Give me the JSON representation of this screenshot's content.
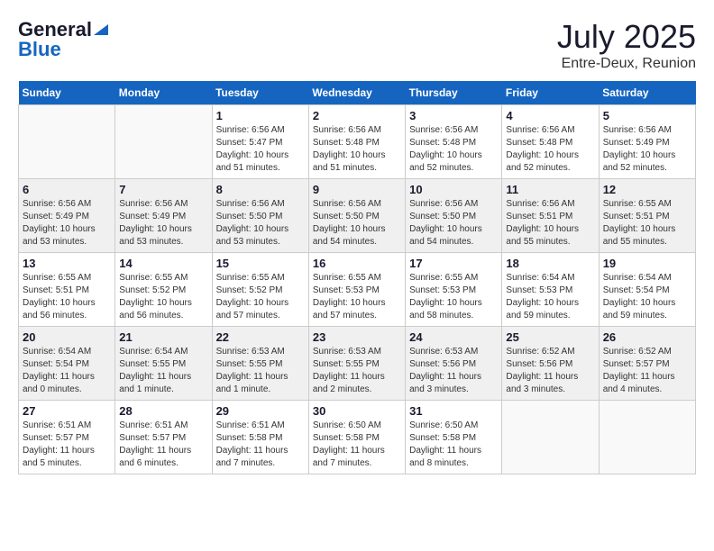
{
  "header": {
    "logo_general": "General",
    "logo_blue": "Blue",
    "month_title": "July 2025",
    "location": "Entre-Deux, Reunion"
  },
  "days_of_week": [
    "Sunday",
    "Monday",
    "Tuesday",
    "Wednesday",
    "Thursday",
    "Friday",
    "Saturday"
  ],
  "weeks": [
    [
      {
        "day": "",
        "info": ""
      },
      {
        "day": "",
        "info": ""
      },
      {
        "day": "1",
        "info": "Sunrise: 6:56 AM\nSunset: 5:47 PM\nDaylight: 10 hours and 51 minutes."
      },
      {
        "day": "2",
        "info": "Sunrise: 6:56 AM\nSunset: 5:48 PM\nDaylight: 10 hours and 51 minutes."
      },
      {
        "day": "3",
        "info": "Sunrise: 6:56 AM\nSunset: 5:48 PM\nDaylight: 10 hours and 52 minutes."
      },
      {
        "day": "4",
        "info": "Sunrise: 6:56 AM\nSunset: 5:48 PM\nDaylight: 10 hours and 52 minutes."
      },
      {
        "day": "5",
        "info": "Sunrise: 6:56 AM\nSunset: 5:49 PM\nDaylight: 10 hours and 52 minutes."
      }
    ],
    [
      {
        "day": "6",
        "info": "Sunrise: 6:56 AM\nSunset: 5:49 PM\nDaylight: 10 hours and 53 minutes."
      },
      {
        "day": "7",
        "info": "Sunrise: 6:56 AM\nSunset: 5:49 PM\nDaylight: 10 hours and 53 minutes."
      },
      {
        "day": "8",
        "info": "Sunrise: 6:56 AM\nSunset: 5:50 PM\nDaylight: 10 hours and 53 minutes."
      },
      {
        "day": "9",
        "info": "Sunrise: 6:56 AM\nSunset: 5:50 PM\nDaylight: 10 hours and 54 minutes."
      },
      {
        "day": "10",
        "info": "Sunrise: 6:56 AM\nSunset: 5:50 PM\nDaylight: 10 hours and 54 minutes."
      },
      {
        "day": "11",
        "info": "Sunrise: 6:56 AM\nSunset: 5:51 PM\nDaylight: 10 hours and 55 minutes."
      },
      {
        "day": "12",
        "info": "Sunrise: 6:55 AM\nSunset: 5:51 PM\nDaylight: 10 hours and 55 minutes."
      }
    ],
    [
      {
        "day": "13",
        "info": "Sunrise: 6:55 AM\nSunset: 5:51 PM\nDaylight: 10 hours and 56 minutes."
      },
      {
        "day": "14",
        "info": "Sunrise: 6:55 AM\nSunset: 5:52 PM\nDaylight: 10 hours and 56 minutes."
      },
      {
        "day": "15",
        "info": "Sunrise: 6:55 AM\nSunset: 5:52 PM\nDaylight: 10 hours and 57 minutes."
      },
      {
        "day": "16",
        "info": "Sunrise: 6:55 AM\nSunset: 5:53 PM\nDaylight: 10 hours and 57 minutes."
      },
      {
        "day": "17",
        "info": "Sunrise: 6:55 AM\nSunset: 5:53 PM\nDaylight: 10 hours and 58 minutes."
      },
      {
        "day": "18",
        "info": "Sunrise: 6:54 AM\nSunset: 5:53 PM\nDaylight: 10 hours and 59 minutes."
      },
      {
        "day": "19",
        "info": "Sunrise: 6:54 AM\nSunset: 5:54 PM\nDaylight: 10 hours and 59 minutes."
      }
    ],
    [
      {
        "day": "20",
        "info": "Sunrise: 6:54 AM\nSunset: 5:54 PM\nDaylight: 11 hours and 0 minutes."
      },
      {
        "day": "21",
        "info": "Sunrise: 6:54 AM\nSunset: 5:55 PM\nDaylight: 11 hours and 1 minute."
      },
      {
        "day": "22",
        "info": "Sunrise: 6:53 AM\nSunset: 5:55 PM\nDaylight: 11 hours and 1 minute."
      },
      {
        "day": "23",
        "info": "Sunrise: 6:53 AM\nSunset: 5:55 PM\nDaylight: 11 hours and 2 minutes."
      },
      {
        "day": "24",
        "info": "Sunrise: 6:53 AM\nSunset: 5:56 PM\nDaylight: 11 hours and 3 minutes."
      },
      {
        "day": "25",
        "info": "Sunrise: 6:52 AM\nSunset: 5:56 PM\nDaylight: 11 hours and 3 minutes."
      },
      {
        "day": "26",
        "info": "Sunrise: 6:52 AM\nSunset: 5:57 PM\nDaylight: 11 hours and 4 minutes."
      }
    ],
    [
      {
        "day": "27",
        "info": "Sunrise: 6:51 AM\nSunset: 5:57 PM\nDaylight: 11 hours and 5 minutes."
      },
      {
        "day": "28",
        "info": "Sunrise: 6:51 AM\nSunset: 5:57 PM\nDaylight: 11 hours and 6 minutes."
      },
      {
        "day": "29",
        "info": "Sunrise: 6:51 AM\nSunset: 5:58 PM\nDaylight: 11 hours and 7 minutes."
      },
      {
        "day": "30",
        "info": "Sunrise: 6:50 AM\nSunset: 5:58 PM\nDaylight: 11 hours and 7 minutes."
      },
      {
        "day": "31",
        "info": "Sunrise: 6:50 AM\nSunset: 5:58 PM\nDaylight: 11 hours and 8 minutes."
      },
      {
        "day": "",
        "info": ""
      },
      {
        "day": "",
        "info": ""
      }
    ]
  ]
}
